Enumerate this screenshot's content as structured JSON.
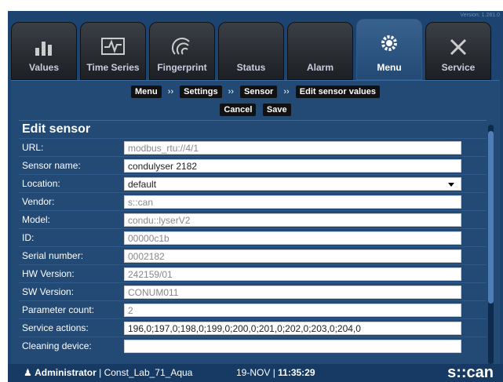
{
  "version": "Version: 1.281.0",
  "tabs": [
    {
      "label": "Values",
      "icon": "bar-chart-icon"
    },
    {
      "label": "Time Series",
      "icon": "waveform-icon"
    },
    {
      "label": "Fingerprint",
      "icon": "fingerprint-icon"
    },
    {
      "label": "Status",
      "icon": "status-icon"
    },
    {
      "label": "Alarm",
      "icon": "alarm-icon"
    },
    {
      "label": "Menu",
      "icon": "gear-icon",
      "active": true
    },
    {
      "label": "Service",
      "icon": "tools-icon"
    }
  ],
  "breadcrumb": {
    "menu": "Menu",
    "settings": "Settings",
    "sensor": "Sensor",
    "current": "Edit sensor values",
    "sep": "››"
  },
  "actions": {
    "cancel": "Cancel",
    "save": "Save"
  },
  "panel": {
    "title": "Edit sensor",
    "fields": [
      {
        "label": "URL:",
        "value": "modbus_rtu://4/1",
        "readonly": true
      },
      {
        "label": "Sensor name:",
        "value": "condulyser 2182",
        "readonly": false
      },
      {
        "label": "Location:",
        "value": "default",
        "readonly": false,
        "select": true
      },
      {
        "label": "Vendor:",
        "value": "s::can",
        "readonly": true
      },
      {
        "label": "Model:",
        "value": "condu::lyserV2",
        "readonly": true
      },
      {
        "label": "ID:",
        "value": "00000c1b",
        "readonly": true
      },
      {
        "label": "Serial number:",
        "value": "0002182",
        "readonly": true
      },
      {
        "label": "HW Version:",
        "value": "242159/01",
        "readonly": true
      },
      {
        "label": "SW Version:",
        "value": "CONUM011",
        "readonly": true
      },
      {
        "label": "Parameter count:",
        "value": "2",
        "readonly": true
      },
      {
        "label": "Service actions:",
        "value": "196,0;197,0;198,0;199,0;200,0;201,0;202,0;203,0;204,0",
        "readonly": false
      },
      {
        "label": "Cleaning device:",
        "value": "",
        "readonly": false
      }
    ]
  },
  "status": {
    "user": "Administrator",
    "location": "Const_Lab_71_Aqua",
    "date": "19-NOV",
    "time": "11:35:29",
    "logo": "s::can"
  }
}
